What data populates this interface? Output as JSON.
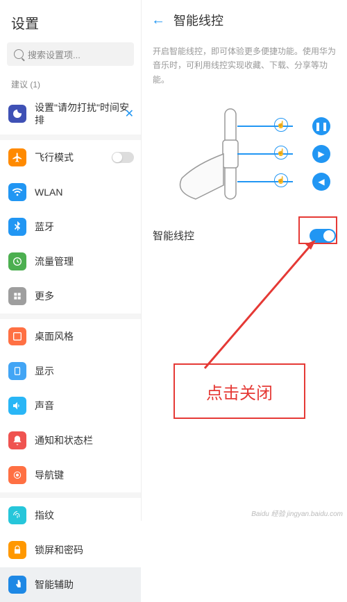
{
  "left": {
    "title": "设置",
    "search_placeholder": "搜索设置项...",
    "suggestions_label": "建议 (1)",
    "dnd_label": "设置\"请勿打扰\"时间安排",
    "items": [
      {
        "label": "飞行模式",
        "color": "#ff8a00",
        "has_switch": true
      },
      {
        "label": "WLAN",
        "color": "#2196f3"
      },
      {
        "label": "蓝牙",
        "color": "#2196f3"
      },
      {
        "label": "流量管理",
        "color": "#4caf50"
      },
      {
        "label": "更多",
        "color": "#9e9e9e"
      }
    ],
    "items2": [
      {
        "label": "桌面风格",
        "color": "#ff7043"
      },
      {
        "label": "显示",
        "color": "#42a5f5"
      },
      {
        "label": "声音",
        "color": "#29b6f6"
      },
      {
        "label": "通知和状态栏",
        "color": "#ef5350"
      },
      {
        "label": "导航键",
        "color": "#ff7043"
      }
    ],
    "items3": [
      {
        "label": "指纹",
        "color": "#26c6da"
      },
      {
        "label": "锁屏和密码",
        "color": "#ff9800"
      },
      {
        "label": "智能辅助",
        "color": "#1e88e5",
        "active": true
      }
    ]
  },
  "right": {
    "title": "智能线控",
    "desc": "开启智能线控，即可体验更多便捷功能。使用华为音乐时，可利用线控实现收藏、下载、分享等功能。",
    "toggle_label": "智能线控"
  },
  "annotation": "点击关闭",
  "watermark": "Baidu 经验 jingyan.baidu.com"
}
